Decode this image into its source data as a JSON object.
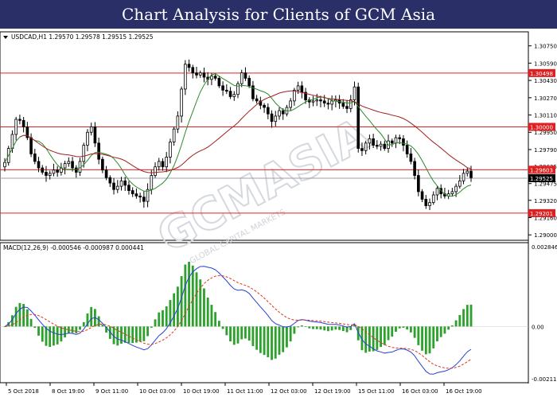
{
  "banner": {
    "title": "Chart Analysis for Clients of GCM Asia"
  },
  "chart_data": {
    "type": "candlestick",
    "symbol_header": "USDCAD,H1  1.29570 1.29578 1.29515 1.29525",
    "watermark": "GCMASIA",
    "watermark_sub": "GLOBAL CAPITAL MARKETS",
    "price_axis": {
      "range": [
        1.2895,
        1.3088
      ],
      "ticks": [
        "1.30750",
        "1.30590",
        "1.30430",
        "1.30270",
        "1.30110",
        "1.29950",
        "1.29790",
        "1.29635",
        "1.29475",
        "1.29320",
        "1.29160",
        "1.29000"
      ]
    },
    "levels": [
      {
        "value": 1.30498,
        "label": "1.30498"
      },
      {
        "value": 1.3,
        "label": "1.30000"
      },
      {
        "value": 1.29603,
        "label": "1.29603"
      },
      {
        "value": 1.29201,
        "label": "1.29201"
      }
    ],
    "current_price": {
      "value": 1.29525,
      "label": "1.29525"
    },
    "time_labels": [
      "5 Oct 2018",
      "8 Oct 19:00",
      "9 Oct 11:00",
      "10 Oct 03:00",
      "10 Oct 19:00",
      "11 Oct 11:00",
      "12 Oct 03:00",
      "12 Oct 19:00",
      "15 Oct 11:00",
      "16 Oct 03:00",
      "16 Oct 19:00"
    ],
    "close": [
      1.2967,
      1.298,
      1.2993,
      1.3007,
      1.3006,
      1.3,
      1.299,
      1.2975,
      1.2968,
      1.2962,
      1.2958,
      1.2955,
      1.2957,
      1.296,
      1.2958,
      1.2962,
      1.2966,
      1.2968,
      1.2962,
      1.2958,
      1.2968,
      1.2983,
      1.2995,
      1.3,
      1.2985,
      1.297,
      1.296,
      1.2953,
      1.2948,
      1.2942,
      1.2945,
      1.295,
      1.2946,
      1.2941,
      1.2938,
      1.2936,
      1.2935,
      1.2931,
      1.2942,
      1.2955,
      1.2963,
      1.2968,
      1.2963,
      1.2972,
      1.2986,
      1.2998,
      1.301,
      1.3035,
      1.3058,
      1.3055,
      1.305,
      1.3048,
      1.305,
      1.3046,
      1.3044,
      1.3047,
      1.3045,
      1.3038,
      1.3034,
      1.3033,
      1.3028,
      1.303,
      1.304,
      1.305,
      1.3045,
      1.3038,
      1.3026,
      1.3024,
      1.302,
      1.3018,
      1.3012,
      1.3005,
      1.301,
      1.3015,
      1.3012,
      1.3018,
      1.3024,
      1.3034,
      1.3038,
      1.3032,
      1.3025,
      1.3023,
      1.3024,
      1.3025,
      1.3024,
      1.3022,
      1.3021,
      1.3024,
      1.3025,
      1.3022,
      1.3019,
      1.3017,
      1.3025,
      1.3037,
      1.298,
      1.2978,
      1.2985,
      1.2989,
      1.2983,
      1.2982,
      1.2984,
      1.298,
      1.2987,
      1.2985,
      1.299,
      1.2989,
      1.2983,
      1.2975,
      1.2968,
      1.2955,
      1.294,
      1.2933,
      1.2927,
      1.293,
      1.2937,
      1.2943,
      1.2938,
      1.2936,
      1.2938,
      1.294,
      1.2945,
      1.295,
      1.2957,
      1.2959,
      1.2953
    ],
    "sma_short_label": "green moving average",
    "macd": {
      "header": "MACD(12,26,9) -0.000546 -0.000987 0.000441",
      "range": [
        -0.00224,
        0.00306
      ],
      "ticks": [
        "0.002846",
        "0.00",
        "-0.002116"
      ],
      "histogram_color": "#2ea02e",
      "macd_color": "#2a3fd6",
      "signal_color": "#e0331f"
    },
    "colors": {
      "up_candle": "#000000",
      "down_candle": "#000000",
      "sma_fast": "#2b8a2b",
      "sma_slow": "#a02020",
      "level_line": "#e02020",
      "level_label_bg": "#e02020",
      "current_label_bg": "#000000"
    }
  }
}
